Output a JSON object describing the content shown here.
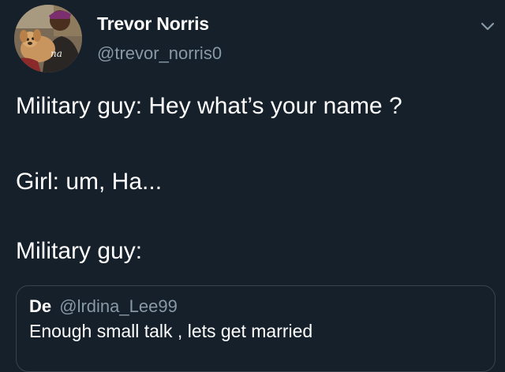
{
  "author": {
    "name": "Trevor Norris",
    "handle": "@trevor_norris0",
    "avatar_caption": "na"
  },
  "icons": {
    "menu": "chevron-down-icon"
  },
  "tweet": {
    "lines": [
      "Military guy: Hey what’s your name ?",
      "Girl: um, Ha...",
      "Military guy:"
    ]
  },
  "quote": {
    "name": "De",
    "handle": "@lrdina_Lee99",
    "text": "Enough small talk , lets get married"
  },
  "colors": {
    "background": "#15202b",
    "primary_text": "#ffffff",
    "secondary_text": "#8899a6",
    "border": "#38444d"
  }
}
